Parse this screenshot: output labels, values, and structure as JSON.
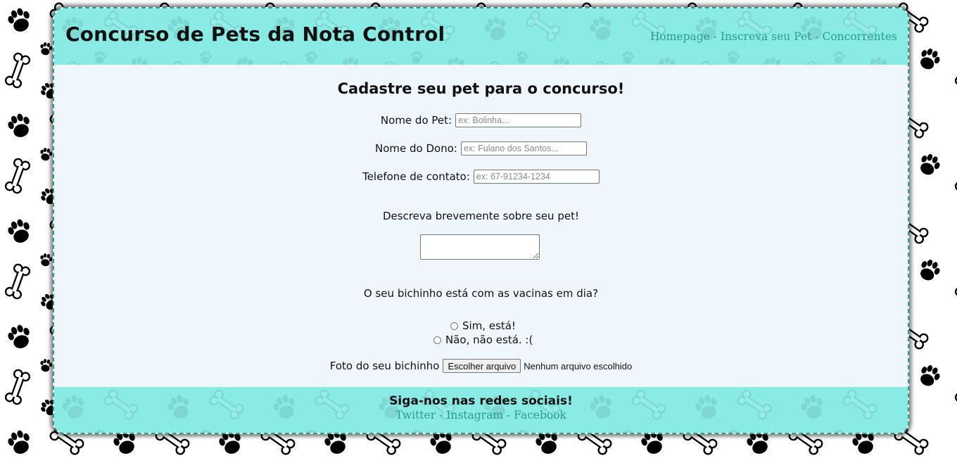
{
  "header": {
    "title": "Concurso de Pets da Nota Control",
    "nav": [
      {
        "label": "Homepage"
      },
      {
        "label": "Inscreva seu Pet"
      },
      {
        "label": "Concorrentes"
      }
    ],
    "separator": "-"
  },
  "form": {
    "title": "Cadastre seu pet para o concurso!",
    "pet_name": {
      "label": "Nome do Pet:",
      "placeholder": "ex: Bolinha..."
    },
    "owner_name": {
      "label": "Nome do Dono:",
      "placeholder": "ex: Fulano dos Santos..."
    },
    "phone": {
      "label": "Telefone de contato:",
      "placeholder": "ex: 67-91234-1234"
    },
    "description_label": "Descreva brevemente sobre seu pet!",
    "vaccine_question": "O seu bichinho está com as vacinas em dia?",
    "vaccine_options": [
      {
        "label": "Sim, está!"
      },
      {
        "label": "Não, não está. :("
      }
    ],
    "photo_label": "Foto do seu bichinho",
    "file_button": "Escolher arquivo",
    "file_status": "Nenhum arquivo escolhido"
  },
  "footer": {
    "title": "Siga-nos nas redes sociais!",
    "links": [
      {
        "label": "Twitter"
      },
      {
        "label": "Instagram"
      },
      {
        "label": "Facebook"
      }
    ],
    "separator": "-"
  },
  "colors": {
    "accent": "#8aebe5",
    "link": "#2a9d8f",
    "content_bg": "#eff7fd",
    "background": "#ffffff",
    "pattern": "#000000"
  },
  "icons": [
    "paw-print-icon",
    "bone-icon"
  ]
}
